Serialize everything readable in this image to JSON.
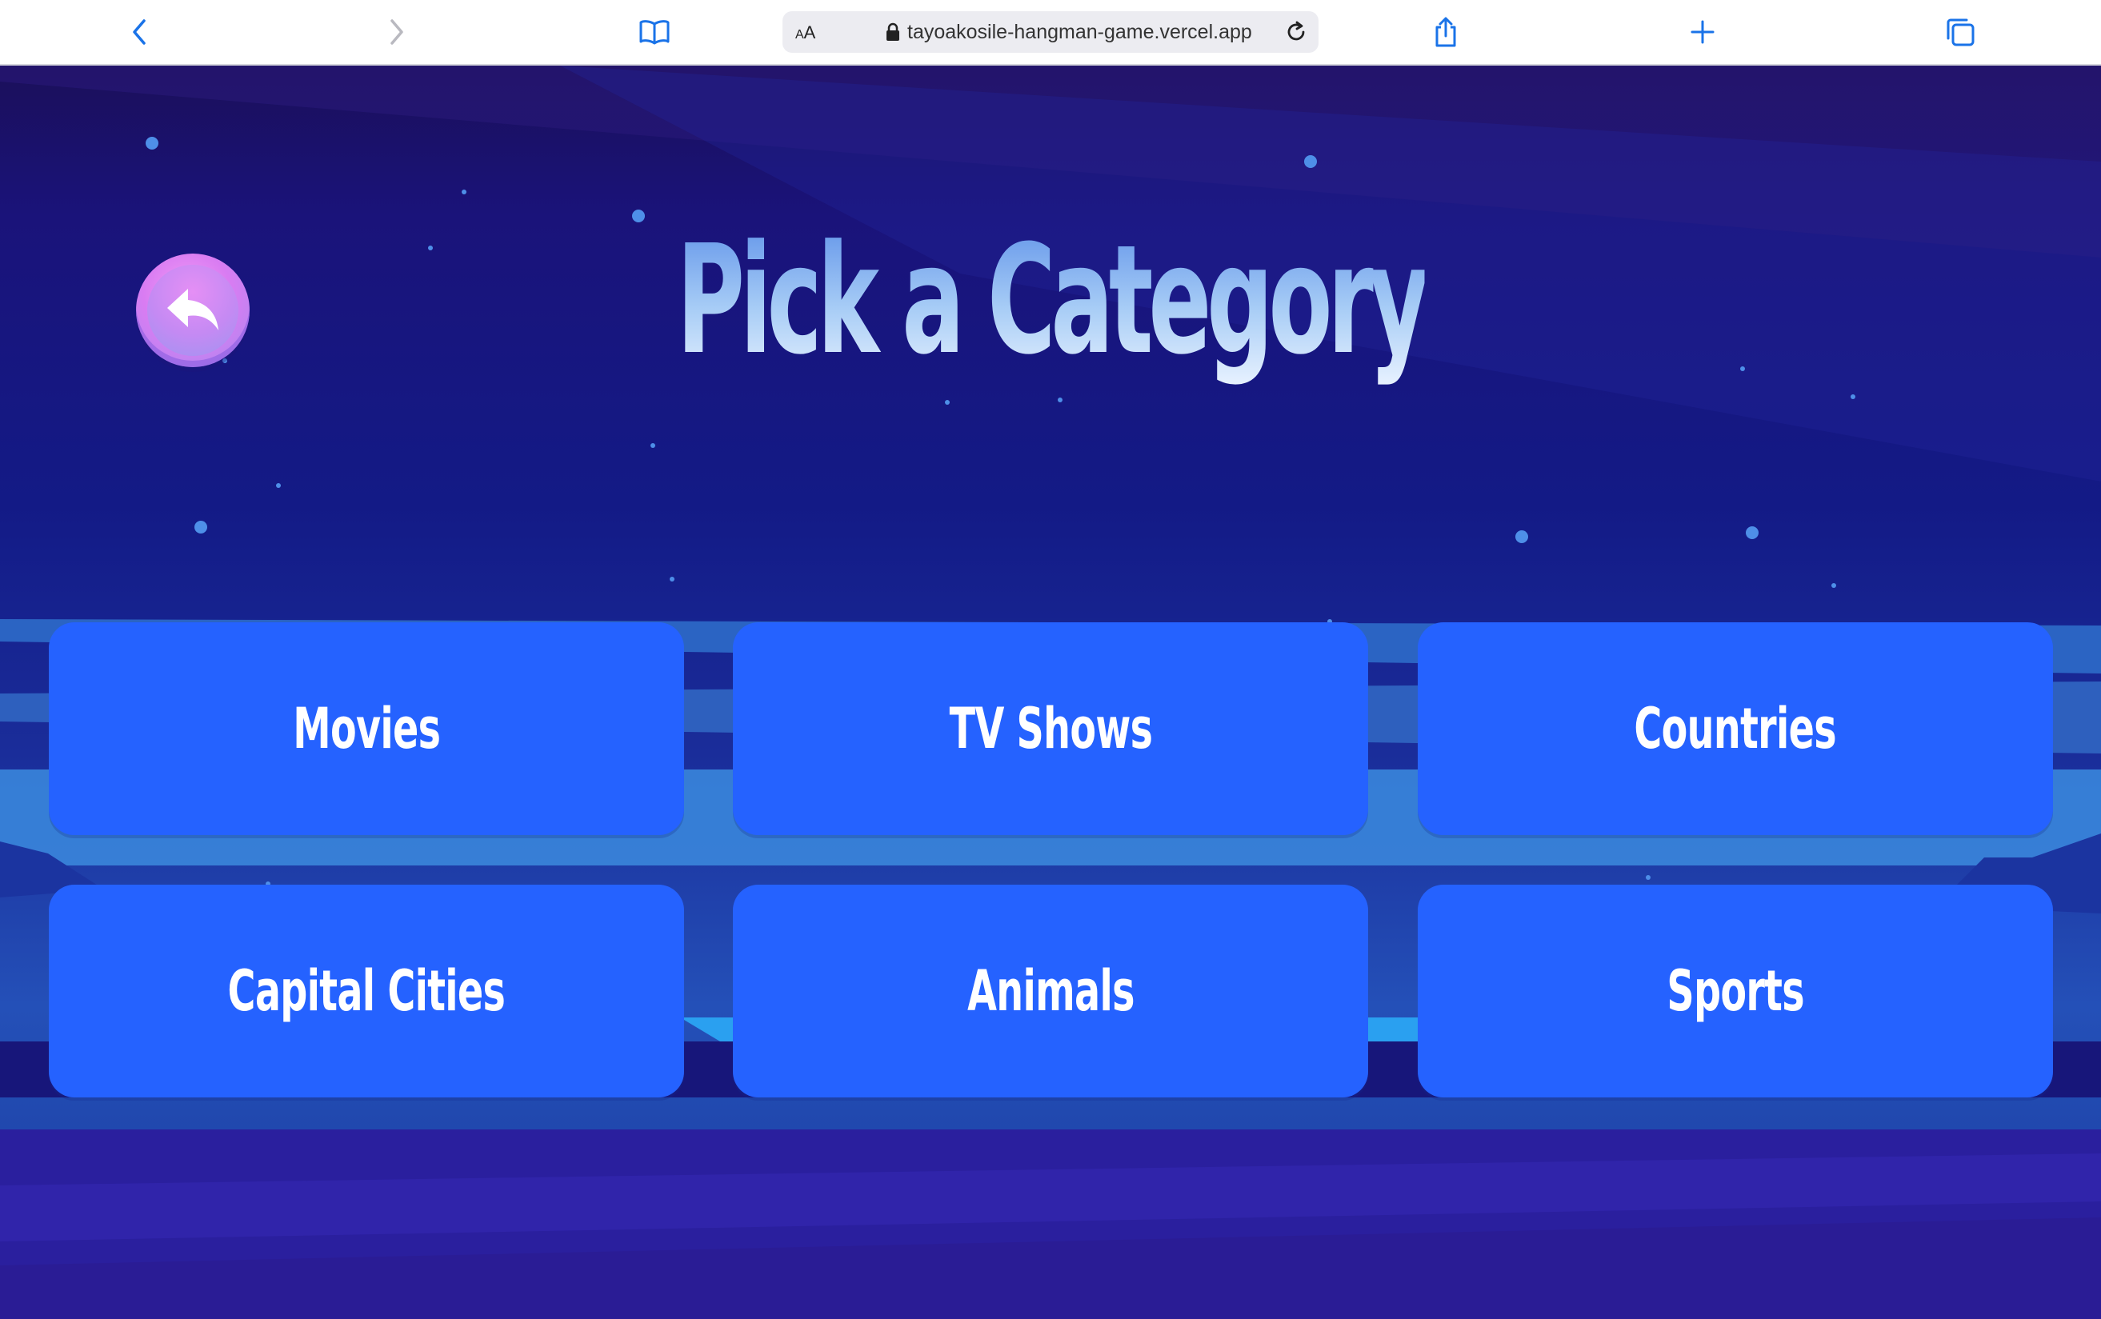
{
  "browser": {
    "aa_label_big": "A",
    "aa_label_small": "A",
    "url": "tayoakosile-hangman-game.vercel.app",
    "icons": {
      "back": "chevron-left-icon",
      "forward": "chevron-right-icon",
      "bookmarks": "book-icon",
      "lock": "lock-icon",
      "reload": "reload-icon",
      "share": "share-icon",
      "new_tab": "plus-icon",
      "tabs": "tabs-icon"
    },
    "accent_color": "#1a73e8"
  },
  "page": {
    "title": "Pick a Category",
    "back_icon": "undo-arrow-icon",
    "categories": [
      {
        "label": "Movies"
      },
      {
        "label": "TV Shows"
      },
      {
        "label": "Countries"
      },
      {
        "label": "Capital Cities"
      },
      {
        "label": "Animals"
      },
      {
        "label": "Sports"
      }
    ],
    "colors": {
      "button": "#2562ff",
      "back_button": "#d97cf2",
      "title_gradient_top": "#5b8fe8",
      "title_gradient_bottom": "#eaf3ff"
    }
  }
}
